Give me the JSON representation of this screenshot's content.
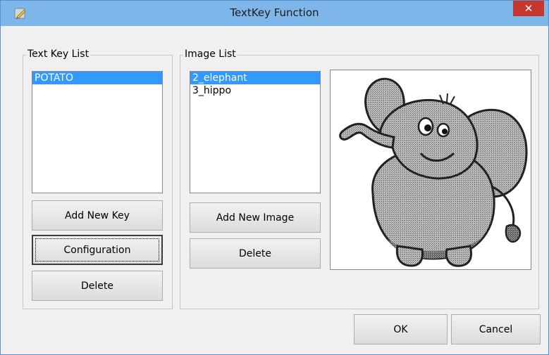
{
  "window": {
    "title": "TextKey Function",
    "close_label": "✕"
  },
  "text_key_group": {
    "legend": "Text Key List",
    "items": [
      "POTATO"
    ],
    "selected_index": 0,
    "buttons": {
      "add_key": "Add New Key",
      "configuration": "Configuration",
      "delete": "Delete"
    }
  },
  "image_group": {
    "legend": "Image List",
    "items": [
      "2_elephant",
      "3_hippo"
    ],
    "selected_index": 0,
    "buttons": {
      "add_image": "Add New Image",
      "delete": "Delete"
    },
    "preview_icon": "elephant-drawing"
  },
  "footer": {
    "ok": "OK",
    "cancel": "Cancel"
  },
  "colors": {
    "titlebar": "#7fb6ea",
    "close": "#c7372e",
    "selection": "#3399ff"
  }
}
